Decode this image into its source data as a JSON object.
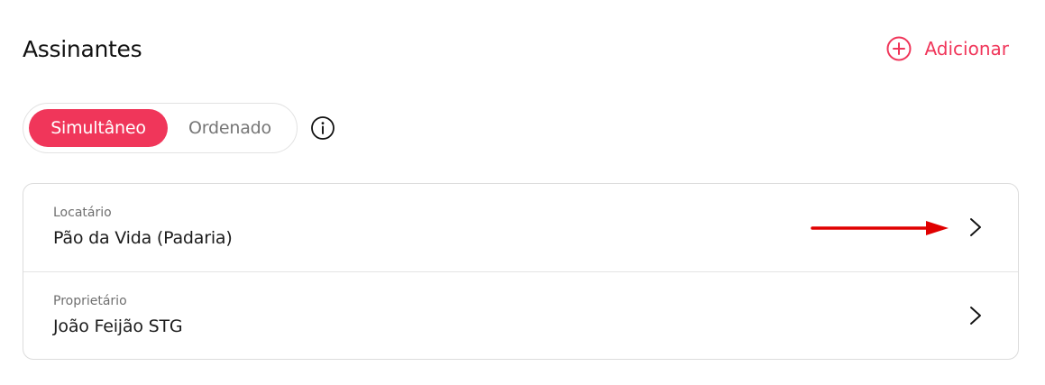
{
  "header": {
    "title": "Assinantes",
    "add_label": "Adicionar",
    "add_icon": "plus-circle-icon"
  },
  "mode_toggle": {
    "options": [
      {
        "label": "Simultâneo",
        "selected": true
      },
      {
        "label": "Ordenado",
        "selected": false
      }
    ],
    "info_icon": "info-circle-icon"
  },
  "signers": [
    {
      "role": "Locatário",
      "name": "Pão da Vida (Padaria)",
      "chevron_icon": "chevron-right-icon"
    },
    {
      "role": "Proprietário",
      "name": "João Feijão STG",
      "chevron_icon": "chevron-right-icon"
    }
  ],
  "colors": {
    "accent": "#f0365a",
    "annotation_arrow": "#e00000",
    "border": "#dcdcdc",
    "muted_text": "#767676"
  }
}
